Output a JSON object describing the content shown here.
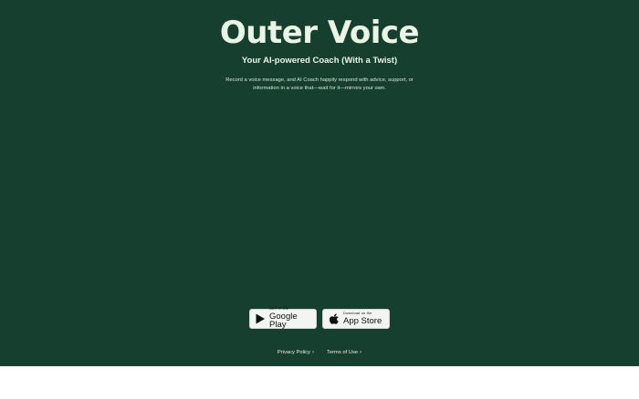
{
  "hero": {
    "title": "Outer Voice",
    "subtitle": "Your AI-powered Coach (With a Twist)",
    "description": "Record a voice message, and AI Coach happily respond with advice, support, or information in a voice that—wait for it—mirrors your own."
  },
  "stores": {
    "google_play": {
      "small": "GET IT ON",
      "big": "Google Play",
      "icon": "google-play-icon"
    },
    "app_store": {
      "small": "Download on the",
      "big": "App Store",
      "icon": "apple-icon"
    }
  },
  "footer": {
    "privacy": "Privacy Policy",
    "terms": "Terms of Use",
    "chevron": "›"
  },
  "colors": {
    "background": "#173f2f",
    "text": "#eaf5e6",
    "badge_bg": "#f2f5f1"
  }
}
